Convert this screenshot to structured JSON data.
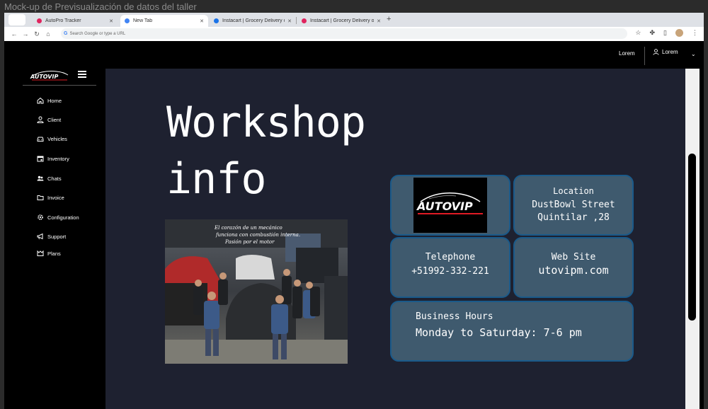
{
  "mockup": {
    "title": "Mock-up de Previsualización de datos del taller"
  },
  "browser": {
    "tabs": [
      {
        "label": "AutoPro Tracker",
        "active": false,
        "color": "#e0245e"
      },
      {
        "label": "New Tab",
        "active": true,
        "color": "#4285f4"
      },
      {
        "label": "Instacart | Grocery Delivery or...",
        "active": false,
        "color": "#1a73e8"
      },
      {
        "label": "Instacart | Grocery Delivery or...",
        "active": false,
        "color": "#e0245e"
      }
    ],
    "address": {
      "placeholder": "Search Google or type a URL"
    }
  },
  "topbar": {
    "link": "Lorem",
    "user": "Lorem"
  },
  "sidebar": {
    "logo": "AUTOVIP",
    "items": [
      {
        "label": "Home",
        "icon": "home-icon"
      },
      {
        "label": "Client",
        "icon": "user-icon"
      },
      {
        "label": "Vehicles",
        "icon": "car-icon"
      },
      {
        "label": "Inventory",
        "icon": "calendar-icon"
      },
      {
        "label": "Chats",
        "icon": "users-icon"
      },
      {
        "label": "Invoice",
        "icon": "folder-icon"
      },
      {
        "label": "Configuration",
        "icon": "gear-icon"
      },
      {
        "label": "Support",
        "icon": "megaphone-icon"
      },
      {
        "label": "Plans",
        "icon": "plans-icon"
      }
    ]
  },
  "main": {
    "heading_line1": "Workshop",
    "heading_line2": "info",
    "photo_caption": "El corazón de un mecánico funciona con combustión interna. Pasión por el motor",
    "logo_text": "AUTOVIP",
    "location": {
      "label": "Location",
      "line1": "DustBowl Street",
      "line2": "Quintilar ,28"
    },
    "telephone": {
      "label": "Telephone",
      "value": "+51992-332-221"
    },
    "website": {
      "label": "Web Site",
      "value": "utovipm.com"
    },
    "hours": {
      "label": "Business Hours",
      "value": "Monday to Saturday: 7-6 pm"
    }
  },
  "colors": {
    "content_bg": "#1e2130",
    "card_bg": "#3f5a6e",
    "card_border": "#1a5a8a",
    "brand_red": "#e01b24"
  }
}
